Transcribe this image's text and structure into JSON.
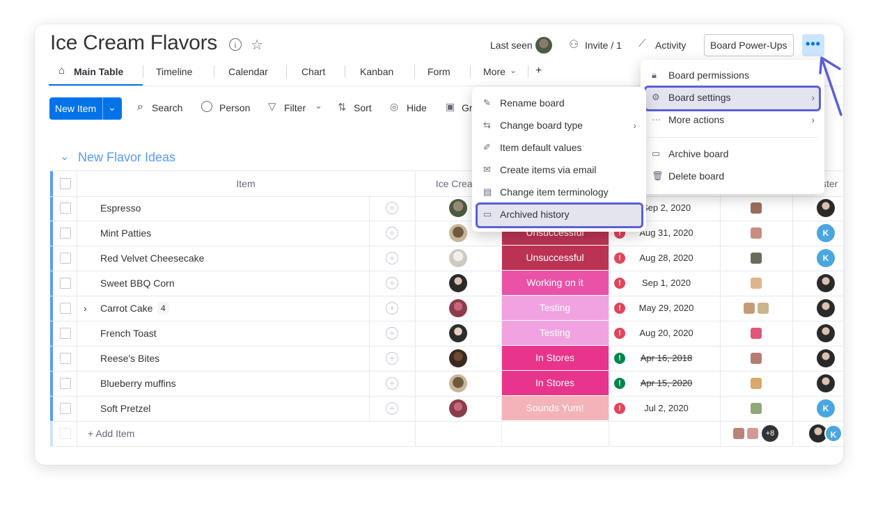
{
  "board": {
    "title": "Ice Cream Flavors",
    "last_seen_label": "Last seen",
    "invite_label": "Invite / 1",
    "activity_label": "Activity",
    "power_ups_label": "Board Power-Ups",
    "more_label": "•••"
  },
  "tabs": [
    {
      "label": "Main Table",
      "icon": "home-icon"
    },
    {
      "label": "Timeline"
    },
    {
      "label": "Calendar"
    },
    {
      "label": "Chart"
    },
    {
      "label": "Kanban"
    },
    {
      "label": "Form"
    },
    {
      "label": "More"
    },
    {
      "label": "+"
    }
  ],
  "toolbar": {
    "new_item_label": "New Item",
    "search_label": "Search",
    "person_label": "Person",
    "filter_label": "Filter",
    "sort_label": "Sort",
    "hide_label": "Hide",
    "group_label": "Gr"
  },
  "group": {
    "title": "New Flavor Ideas",
    "color": "#579bfc",
    "columns": {
      "item": "Item",
      "ice_cream": "Ice Crea...",
      "tester": "ster"
    },
    "add_item_label": "+ Add Item",
    "summary_more": "+8",
    "rows": [
      {
        "name": "Espresso",
        "status": "",
        "status_color": "#ffffff",
        "date": "Sep 2, 2020",
        "date_status": "alert",
        "strike": false
      },
      {
        "name": "Mint Patties",
        "status": "Unsuccessful",
        "status_color": "#bb3354",
        "date": "Aug 31, 2020",
        "date_status": "alert",
        "strike": false
      },
      {
        "name": "Red Velvet Cheesecake",
        "status": "Unsuccessful",
        "status_color": "#bb3354",
        "date": "Aug 28, 2020",
        "date_status": "alert",
        "strike": false
      },
      {
        "name": "Sweet BBQ Corn",
        "status": "Working on it",
        "status_color": "#e952a6",
        "date": "Sep 1, 2020",
        "date_status": "alert",
        "strike": false
      },
      {
        "name": "Carrot Cake",
        "subitems": "4",
        "status": "Testing",
        "status_color": "#f0a3e0",
        "date": "May 29, 2020",
        "date_status": "alert",
        "strike": false
      },
      {
        "name": "French Toast",
        "status": "Testing",
        "status_color": "#f0a3e0",
        "date": "Aug 20, 2020",
        "date_status": "alert",
        "strike": false
      },
      {
        "name": "Reese's Bites",
        "status": "In Stores",
        "status_color": "#e8348a",
        "date": "Apr 16, 2018",
        "date_status": "done",
        "strike": true
      },
      {
        "name": "Blueberry muffins",
        "status": "In Stores",
        "status_color": "#e8348a",
        "date": "Apr 15, 2020",
        "date_status": "done",
        "strike": true
      },
      {
        "name": "Soft Pretzel",
        "status": "Sounds Yum!",
        "status_color": "#f4b3b8",
        "date": "Jul 2, 2020",
        "date_status": "alert",
        "strike": false
      }
    ]
  },
  "board_menu": {
    "items": [
      {
        "label": "Board permissions",
        "icon": "lock-icon"
      },
      {
        "label": "Board settings",
        "icon": "gear-icon",
        "submenu": true,
        "highlighted": true
      },
      {
        "label": "More actions",
        "icon": "dots-icon",
        "submenu": true
      },
      {
        "label": "Archive board",
        "icon": "archive-icon"
      },
      {
        "label": "Delete board",
        "icon": "trash-icon"
      }
    ]
  },
  "settings_menu": {
    "items": [
      {
        "label": "Rename board",
        "icon": "pencil-icon"
      },
      {
        "label": "Change board type",
        "icon": "swap-icon",
        "submenu": true
      },
      {
        "label": "Item default values",
        "icon": "pen-line-icon"
      },
      {
        "label": "Create items via email",
        "icon": "mail-icon"
      },
      {
        "label": "Change item terminology",
        "icon": "id-card-icon"
      },
      {
        "label": "Archived history",
        "icon": "archive-icon",
        "highlighted": true
      }
    ]
  },
  "colors": {
    "accent": "#0073ea",
    "highlight_border": "#5a5fd6",
    "alert": "#e2445c",
    "done": "#00854d"
  }
}
